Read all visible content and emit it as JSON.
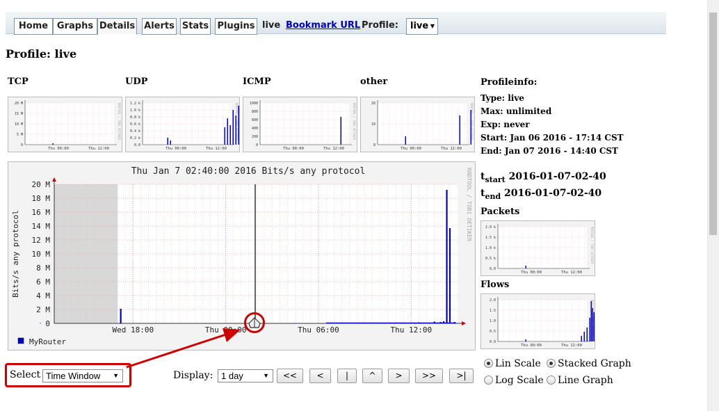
{
  "nav": {
    "tabs": [
      "Home",
      "Graphs",
      "Details",
      "Alerts",
      "Stats",
      "Plugins"
    ],
    "active_tab": "Details",
    "profile_name": "live",
    "bookmark_label": "Bookmark URL",
    "profile_label": "Profile:",
    "profile_select": "live"
  },
  "page_title": "Profile: live",
  "mini_charts": {
    "tcp": {
      "title": "TCP",
      "yticks": [
        "20 M",
        "15 M",
        "10 M",
        "5 M",
        "0"
      ],
      "xticks": [
        "Thu 00:00",
        "Thu 12:00"
      ]
    },
    "udp": {
      "title": "UDP",
      "yticks": [
        "1.2 k",
        "1.0 k",
        "0.8 k",
        "0.6 k",
        "0.4 k",
        "0.2 k",
        "0.0"
      ],
      "xticks": [
        "Thu 00:00",
        "Thu 12:00"
      ]
    },
    "icmp": {
      "title": "ICMP",
      "yticks": [
        "1000",
        "800",
        "600",
        "400",
        "200",
        "0"
      ],
      "xticks": [
        "Thu 00:00",
        "Thu 12:00"
      ]
    },
    "other": {
      "title": "other",
      "yticks": [
        "20",
        "10",
        "0"
      ],
      "xticks": [
        "Thu 00:00",
        "Thu 12:00"
      ]
    },
    "packets": {
      "title": "Packets",
      "yticks": [
        "2.0 k",
        "1.5 k",
        "1.0 k",
        "0.5 k",
        "0.0"
      ],
      "xticks": [
        "Thu 00:00",
        "Thu 12:00"
      ]
    },
    "flows": {
      "title": "Flows",
      "yticks": [
        "2.0",
        "1.5",
        "1.0",
        "0.5",
        "0.0"
      ],
      "xticks": [
        "Thu 00:00",
        "Thu 12:00"
      ]
    },
    "watermark": "RRDTOOL / TOBI OETIKER"
  },
  "main_chart": {
    "title": "Thu Jan  7 02:40:00 2016 Bits/s any protocol",
    "ylabel": "Bits/s any protocol",
    "legend": "MyRouter",
    "watermark": "RRDTOOL / TOBI OETIKER",
    "series_color": "#0000cc"
  },
  "chart_data": {
    "type": "bar",
    "title": "Thu Jan  7 02:40:00 2016 Bits/s any protocol",
    "ylabel": "Bits/s any protocol",
    "xlabel": "",
    "ylim": [
      0,
      20
    ],
    "yticks": [
      "0",
      "2 M",
      "4 M",
      "6 M",
      "8 M",
      "10 M",
      "12 M",
      "14 M",
      "16 M",
      "18 M",
      "20 M"
    ],
    "xticks": [
      "Wed 18:00",
      "Thu 00:00",
      "Thu 06:00",
      "Thu 12:00"
    ],
    "x_hours": [
      12.0,
      17.2,
      28.5,
      33.0,
      34.0,
      35.0,
      36.5,
      37.5,
      37.9,
      38.1,
      38.3,
      38.5,
      38.8
    ],
    "x_labels_hours": [
      18,
      24,
      30,
      36
    ],
    "series": [
      {
        "name": "MyRouter",
        "values": [
          0.05,
          2.1,
          0.05,
          0.1,
          0.1,
          0.1,
          0.15,
          0.25,
          0.2,
          0.3,
          19.2,
          13.7,
          0.2
        ]
      }
    ],
    "cursor_label": "Thu Jan  7 02:40:00 2016",
    "grid": true,
    "legend_position": "bottom-left"
  },
  "profileinfo": {
    "heading": "Profileinfo:",
    "rows": [
      "Type: live",
      "Max:  unlimited",
      "Exp:   never",
      "Start: Jan 06 2016 - 17:14 CST",
      "End:   Jan 07 2016 - 14:40 CST"
    ]
  },
  "times": {
    "tstart_sym": "t",
    "tstart_sub": "start",
    "tstart": "2016-01-07-02-40",
    "tend_sym": "t",
    "tend_sub": "end",
    "tend": "2016-01-07-02-40"
  },
  "controls": {
    "select_label": "Select",
    "select_value": "Time Window",
    "display_label": "Display:",
    "display_value": "1 day",
    "buttons": [
      "<<",
      "<",
      "|",
      "^",
      ">",
      ">>",
      ">|"
    ],
    "lin_scale": "Lin Scale",
    "log_scale": "Log Scale",
    "stacked_graph": "Stacked Graph",
    "line_graph": "Line Graph",
    "scale": "lin",
    "graph": "stacked"
  },
  "colors": {
    "annotation": "#cc0000",
    "highlight_box": "#cc0000"
  }
}
